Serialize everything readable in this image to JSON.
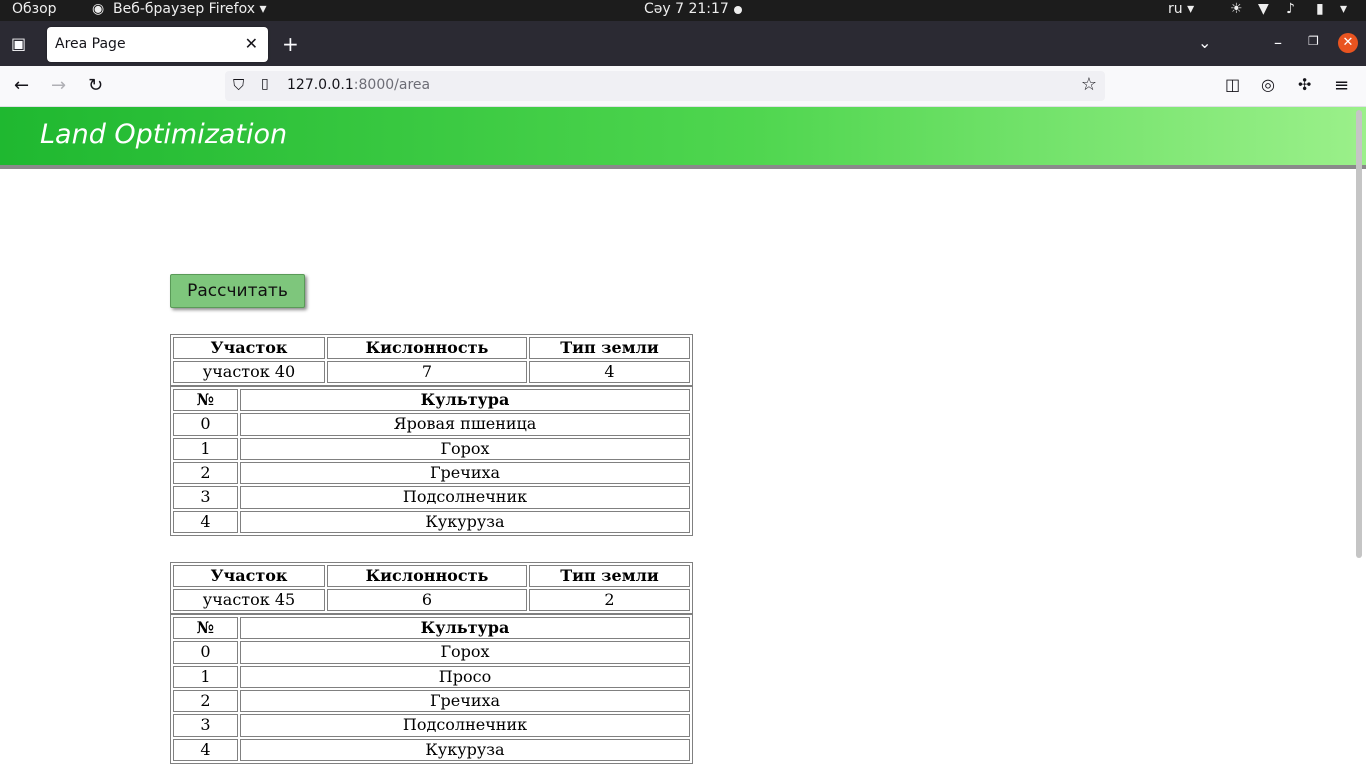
{
  "system_bar": {
    "overview": "Обзор",
    "app_name": "Веб-браузер Firefox",
    "datetime": "Сәу 7  21:17",
    "language": "ru"
  },
  "browser": {
    "tab_title": "Area Page",
    "url_host": "127.0.0.1",
    "url_path": ":8000/area"
  },
  "page": {
    "header_title": "Land Optimization",
    "calculate_button": "Рассчитать",
    "plots": [
      {
        "headers": [
          "Участок",
          "Кислонность",
          "Тип земли"
        ],
        "plot_name": "участок 40",
        "acidity": "7",
        "soil_type": "4",
        "crop_headers": [
          "№",
          "Культура"
        ],
        "crops": [
          {
            "n": "0",
            "name": "Яровая пшеница"
          },
          {
            "n": "1",
            "name": "Горох"
          },
          {
            "n": "2",
            "name": "Гречиха"
          },
          {
            "n": "3",
            "name": "Подсолнечник"
          },
          {
            "n": "4",
            "name": "Кукуруза"
          }
        ]
      },
      {
        "headers": [
          "Участок",
          "Кислонность",
          "Тип земли"
        ],
        "plot_name": "участок 45",
        "acidity": "6",
        "soil_type": "2",
        "crop_headers": [
          "№",
          "Культура"
        ],
        "crops": [
          {
            "n": "0",
            "name": "Горох"
          },
          {
            "n": "1",
            "name": "Просо"
          },
          {
            "n": "2",
            "name": "Гречиха"
          },
          {
            "n": "3",
            "name": "Подсолнечник"
          },
          {
            "n": "4",
            "name": "Кукуруза"
          }
        ]
      }
    ]
  }
}
